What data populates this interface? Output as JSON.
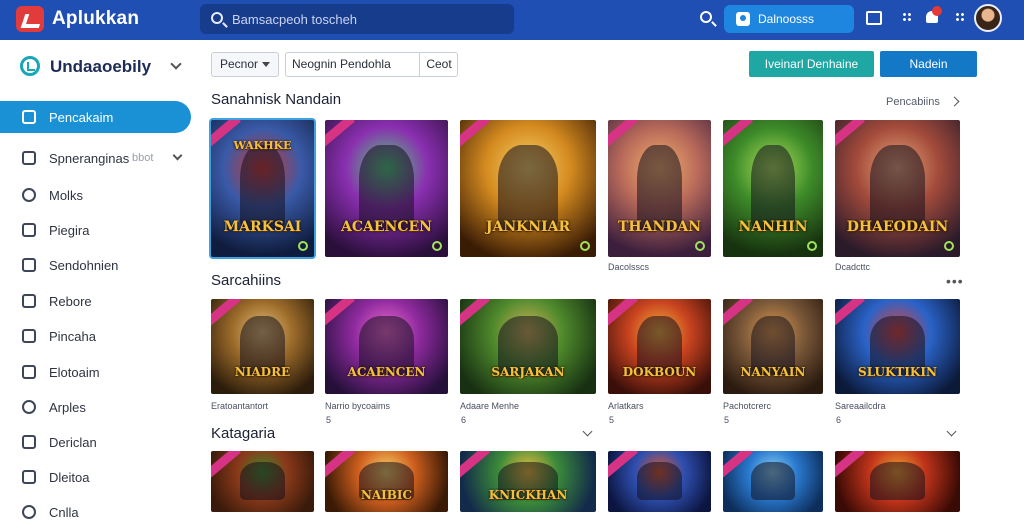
{
  "header": {
    "app_title": "Aplukkan",
    "search_placeholder": "Bamsacpeoh toscheh",
    "download_label": "Dalnoosss",
    "colors": {
      "bar": "#1f4fb2",
      "accent": "#1f86e0"
    }
  },
  "sidebar": {
    "brand": "Undaaoebily",
    "items": [
      {
        "label": "Pencakaim",
        "active": true,
        "icon": "home-icon"
      },
      {
        "label": "Spneranginas",
        "sub": "bbot",
        "icon": "layers-icon",
        "expandable": true
      },
      {
        "label": "Molks",
        "icon": "chat-icon"
      },
      {
        "label": "Piegira",
        "icon": "folder-icon"
      },
      {
        "label": "Sendohnien",
        "icon": "user-icon"
      },
      {
        "label": "Rebore",
        "icon": "box-icon"
      },
      {
        "label": "Pincaha",
        "icon": "tag-icon"
      },
      {
        "label": "Elotoaim",
        "icon": "user-icon"
      },
      {
        "label": "Arples",
        "icon": "circle-icon"
      },
      {
        "label": "Dericlan",
        "icon": "gift-icon"
      },
      {
        "label": "Dleitoa",
        "icon": "doc-icon"
      },
      {
        "label": "Cnlla",
        "icon": "settings-icon"
      }
    ]
  },
  "filters": {
    "select_value": "Pecnor",
    "input_value": "Neognin Pendohla",
    "clear_label": "Ceot",
    "primary_label": "Nadein",
    "secondary_label": "Iveinarl Denhaine"
  },
  "sections": [
    {
      "title": "Sanahnisk Nandain",
      "see_all": "Pencabiins",
      "cards": [
        {
          "title": "MARKSAI",
          "subtitle": "WAKHKE",
          "palette": [
            "#0f1c3d",
            "#3a5aa8",
            "#d1392f"
          ],
          "selected": true
        },
        {
          "title": "ACAENCEN",
          "palette": [
            "#2b0f3b",
            "#8a2fb0",
            "#4fd07a"
          ]
        },
        {
          "title": "JANKNIAR",
          "palette": [
            "#3a1c05",
            "#d48a1f",
            "#f7d36a"
          ]
        },
        {
          "title": "THANDAN",
          "palette": [
            "#3c1f3d",
            "#b96a5a",
            "#f2b26b"
          ],
          "meta": "Dacolsscs"
        },
        {
          "title": "NANHIN",
          "palette": [
            "#17320f",
            "#3e8c2a",
            "#b0e05a"
          ]
        },
        {
          "title": "DHAEODAIN",
          "palette": [
            "#2a1a2a",
            "#a34b3b",
            "#e8a87a"
          ],
          "meta": "Dcadcttc"
        }
      ]
    },
    {
      "title": "Sarcahiins",
      "cards": [
        {
          "title": "NIADRE",
          "palette": [
            "#2c1c0b",
            "#9c6b2a",
            "#e6c07a"
          ],
          "meta": "Eratoantantort"
        },
        {
          "title": "ACAENCEN",
          "palette": [
            "#25103a",
            "#8e2a9e",
            "#f06bd0"
          ],
          "meta": "Narrio bycoaims",
          "count": "5"
        },
        {
          "title": "SARJAKAN",
          "palette": [
            "#173012",
            "#4f8a2c",
            "#d1b35a"
          ],
          "meta": "Adaare Menhe",
          "count": "6"
        },
        {
          "title": "DOKBOUN",
          "palette": [
            "#3a0f0a",
            "#c9431f",
            "#f3b13c"
          ],
          "meta": "Arlatkars",
          "count": "5"
        },
        {
          "title": "NANYAIN",
          "palette": [
            "#2a1a10",
            "#7d5a3a",
            "#e09a4a"
          ],
          "meta": "Pachotcrerc",
          "count": "5"
        },
        {
          "title": "SLUKTIKIN",
          "palette": [
            "#0c1a3a",
            "#2a63c8",
            "#e0443a"
          ],
          "meta": "Sareaailcdra",
          "count": "6"
        }
      ]
    },
    {
      "title": "Katagaria",
      "cards": [
        {
          "title": "",
          "palette": [
            "#3a1a0a",
            "#8a3a1a",
            "#3e8c2a"
          ]
        },
        {
          "title": "NAIBIC",
          "palette": [
            "#3a1a05",
            "#d0601f",
            "#f7d36a"
          ]
        },
        {
          "title": "KNICKHAN",
          "palette": [
            "#132a4a",
            "#3a8a3a",
            "#f3c13c"
          ]
        },
        {
          "title": "",
          "palette": [
            "#0c1540",
            "#2f4fb0",
            "#e05a2a"
          ]
        },
        {
          "title": "",
          "palette": [
            "#0d2d5a",
            "#2a7ad0",
            "#8ad0f0"
          ]
        },
        {
          "title": "",
          "palette": [
            "#3a0a05",
            "#c0341a",
            "#f0a030"
          ]
        }
      ]
    }
  ]
}
